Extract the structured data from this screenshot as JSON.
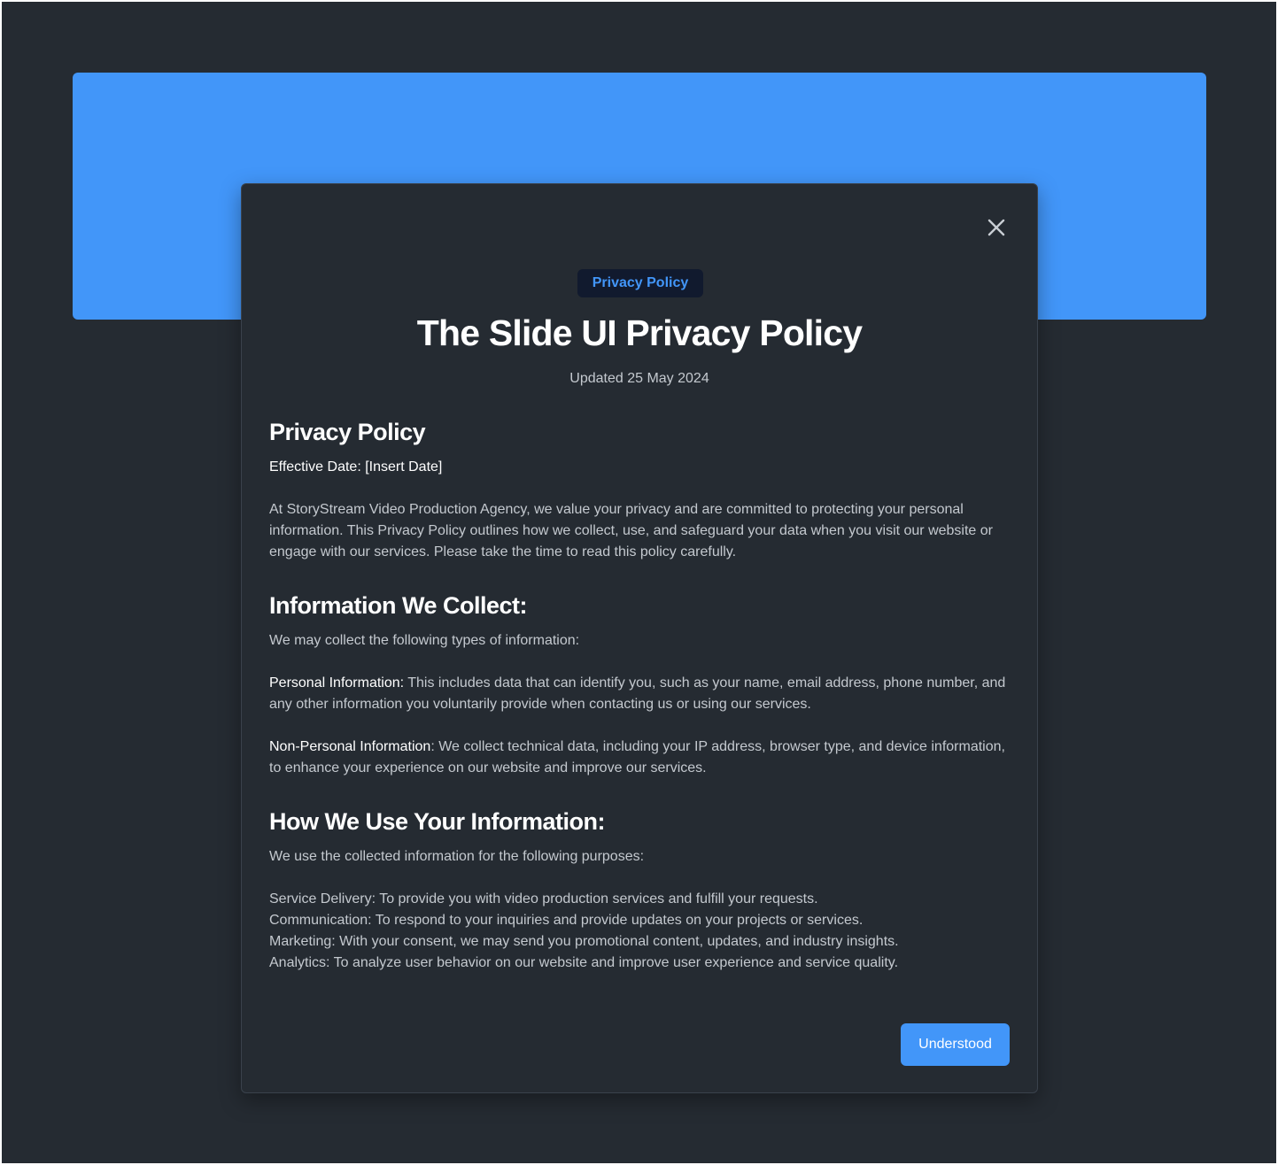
{
  "modal": {
    "close_icon": "close-icon",
    "badge": "Privacy Policy",
    "title": "The Slide UI Privacy Policy",
    "updated": "Updated 25 May 2024",
    "sections": {
      "intro": {
        "heading": "Privacy Policy",
        "effective_date": "Effective Date: [Insert Date]",
        "paragraph": "At StoryStream Video Production Agency, we value your privacy and are committed to protecting your personal information. This Privacy Policy outlines how we collect, use, and safeguard your data when you visit our website or engage with our services. Please take the time to read this policy carefully."
      },
      "collect": {
        "heading": "Information We Collect:",
        "lead": "We may collect the following types of information:",
        "personal_label": "Personal Information:",
        "personal_text": " This includes data that can identify you, such as your name, email address, phone number, and any other information you voluntarily provide when contacting us or using our services.",
        "nonpersonal_label": "Non-Personal Information",
        "nonpersonal_text": ": We collect technical data, including your IP address, browser type, and device information, to enhance your experience on our website and improve our services."
      },
      "use": {
        "heading": "How We Use Your Information:",
        "lead": "We use the collected information for the following purposes:",
        "items": [
          "Service Delivery: To provide you with video production services and fulfill your requests.",
          "Communication: To respond to your inquiries and provide updates on your projects or services.",
          "Marketing: With your consent, we may send you promotional content, updates, and industry insights.",
          "Analytics: To analyze user behavior on our website and improve user experience and service quality."
        ]
      }
    },
    "button": "Understood"
  },
  "colors": {
    "background": "#252b32",
    "accent": "#4296f9",
    "badge_bg": "#111a2e",
    "heading": "#ffffff",
    "body_text": "#c4c9cf"
  }
}
